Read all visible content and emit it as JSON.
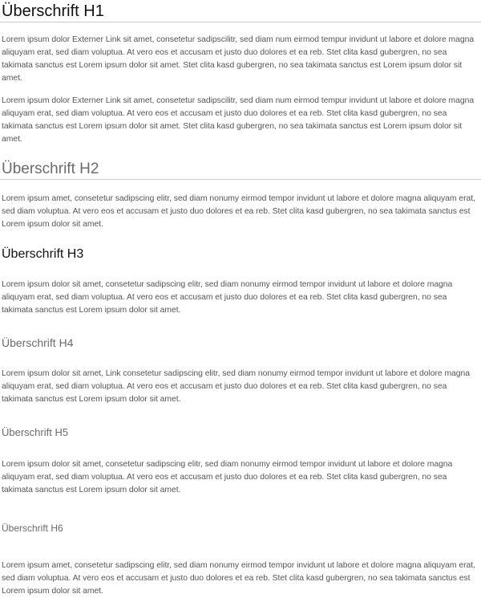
{
  "headings": {
    "h1": "Überschrift H1",
    "h2": "Überschrift H2",
    "h3": "Überschrift H3",
    "h4": "Überschrift H4",
    "h5": "Überschrift H5",
    "h6": "Überschrift H6"
  },
  "paragraphs": {
    "p1": {
      "before": "Lorem ipsum dolor ",
      "link": "Externer Link",
      "after": " sit amet, consetetur sadipscilitr, sed diam num eirmod tempur invidunt ut labore et dolore magna aliquyam erat, sed diam voluptua. At vero eos et accusam et justo duo dolores et ea reb. Stet clita kasd gubergren, no sea takimata sanctus est Lorem ipsum dolor sit amet. Stet clita kasd gubergren, no sea takimata sanctus est Lorem ipsum dolor sit amet."
    },
    "p2": {
      "before": "Lorem ipsum dolor ",
      "link": "Externer Link",
      "after": " sit amet, consetetur sadipscilitr, sed diam num eirmod tempur invidunt ut labore et dolore magna aliquyam erat, sed diam voluptua. At vero eos et accusam et justo duo dolores et ea reb. Stet clita kasd gubergren, no sea takimata sanctus est Lorem ipsum dolor sit amet. Stet clita kasd gubergren, no sea takimata sanctus est Lorem ipsum dolor sit amet."
    },
    "p3": "Lorem ipsum amet, consetetur sadipscing elitr, sed diam nonumy eirmod tempor invidunt ut labore et dolore magna aliquyam erat, sed diam voluptua. At vero eos et accusam et justo duo dolores et ea reb. Stet clita kasd gubergren, no sea takimata sanctus est Lorem ipsum dolor sit amet.",
    "p4": "Lorem ipsum dolor sit amet, consetetur sadipscing elitr, sed diam nonumy eirmod tempor invidunt ut labore et dolore magna aliquyam erat, sed diam voluptua. At vero eos et accusam et justo duo dolores et ea reb. Stet clita kasd gubergren, no sea takimata sanctus est Lorem ipsum dolor sit amet.",
    "p5": {
      "before": "Lorem ipsum dolor sit amet, ",
      "link": "Link",
      "after": " consetetur sadipscing elitr, sed diam nonumy eirmod tempor invidunt ut labore et dolore magna aliquyam erat, sed diam voluptua. At vero eos et accusam et justo duo dolores et ea reb. Stet clita kasd gubergren, no sea takimata sanctus est Lorem ipsum dolor sit amet."
    },
    "p6": "Lorem ipsum dolor sit amet, consetetur sadipscing elitr, sed diam nonumy eirmod tempor invidunt ut labore et dolore magna aliquyam erat, sed diam voluptua. At vero eos et accusam et justo duo dolores et ea reb. Stet clita kasd gubergren, no sea takimata sanctus est Lorem ipsum dolor sit amet.",
    "p7": "Lorem ipsum amet, consetetur sadipscing elitr, sed diam nonumy eirmod tempor invidunt ut labore et dolore magna aliquyam erat, sed diam voluptua. At vero eos et accusam et justo duo dolores et ea reb. Stet clita kasd gubergren, no sea takimata sanctus est Lorem ipsum dolor sit amet."
  },
  "colors": {
    "heading_dark": "#111111",
    "heading_gray": "#6b6b6b",
    "body_text": "#555555",
    "rule": "#cccccc"
  }
}
